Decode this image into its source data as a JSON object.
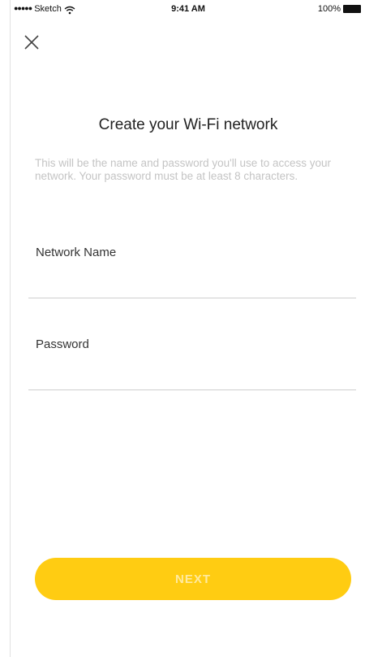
{
  "status_bar": {
    "carrier": "Sketch",
    "time": "9:41 AM",
    "battery": "100%"
  },
  "colors": {
    "accent": "#ffcc12",
    "button_text": "#ffeaa0",
    "description_text": "#c4c4c4"
  },
  "header": {
    "close_icon": "close-icon"
  },
  "main": {
    "title": "Create your Wi-Fi network",
    "description": "This will be the name and password you'll use to access your network. Your password must be at least 8 characters.",
    "fields": [
      {
        "label": "Network Name",
        "value": "",
        "placeholder": ""
      },
      {
        "label": "Password",
        "value": "",
        "placeholder": ""
      }
    ]
  },
  "footer": {
    "next_label": "NEXT"
  }
}
